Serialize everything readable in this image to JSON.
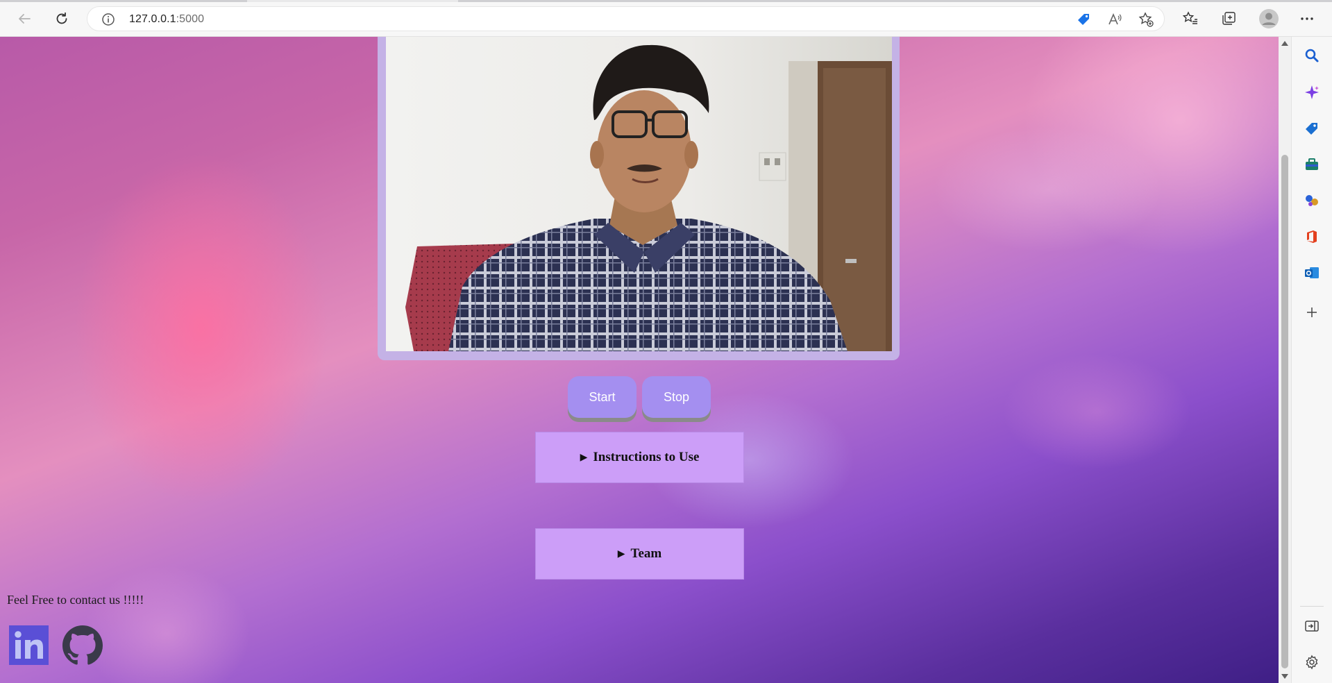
{
  "browser": {
    "address": {
      "host": "127.0.0.1",
      "port": ":5000"
    },
    "toolbar_icons": [
      "back-icon",
      "refresh-icon",
      "info-icon",
      "shopping-tag-icon",
      "read-aloud-icon",
      "add-favorite-icon",
      "favorites-icon",
      "collections-icon",
      "profile-icon",
      "more-icon"
    ],
    "sidebar_icons": [
      "search-icon",
      "copilot-icon",
      "shopping-icon",
      "tools-icon",
      "games-icon",
      "office-icon",
      "outlook-icon",
      "add-icon",
      "hide-sidebar-icon",
      "settings-icon"
    ]
  },
  "page": {
    "buttons": {
      "start": "Start",
      "stop": "Stop"
    },
    "sections": {
      "instructions": "Instructions to Use",
      "team": "Team",
      "marker": "▶"
    },
    "contact_text": "Feel Free to contact us !!!!!",
    "social": [
      "linkedin-icon",
      "github-icon"
    ]
  },
  "colors": {
    "button_bg": "#a48ff0",
    "details_bg": "#cc9ef8",
    "frame_bg": "#c4b2e6"
  }
}
